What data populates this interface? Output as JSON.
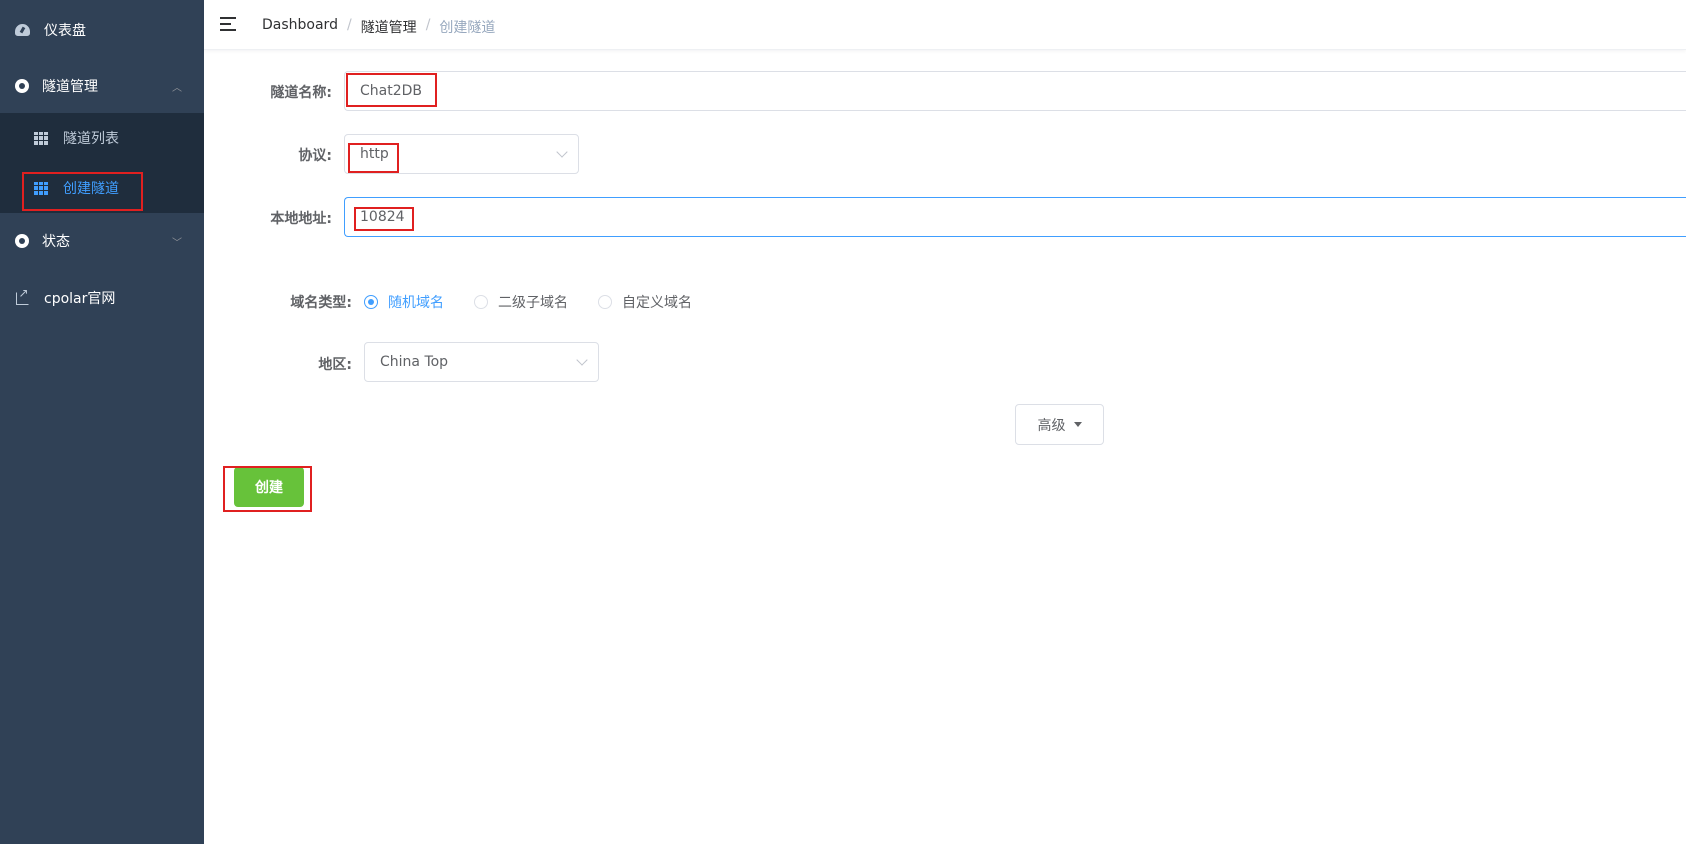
{
  "sidebar": {
    "dashboard": {
      "label": "仪表盘",
      "icon": "dashboard-icon"
    },
    "tunnel_mgmt": {
      "label": "隧道管理",
      "icon": "tunnel-icon",
      "expanded": true
    },
    "tunnel_list": {
      "label": "隧道列表",
      "icon": "table-icon"
    },
    "create_tunnel": {
      "label": "创建隧道",
      "icon": "table-icon",
      "active": true
    },
    "status": {
      "label": "状态",
      "icon": "status-icon"
    },
    "cpolar_site": {
      "label": "cpolar官网",
      "icon": "external-link-icon"
    }
  },
  "header": {
    "breadcrumb": [
      "Dashboard",
      "隧道管理",
      "创建隧道"
    ],
    "separator": "/"
  },
  "form": {
    "name": {
      "label": "隧道名称:",
      "value": "Chat2DB"
    },
    "protocol": {
      "label": "协议:",
      "value": "http"
    },
    "local_address": {
      "label": "本地地址:",
      "value": "10824"
    },
    "domain_type": {
      "label": "域名类型:",
      "options": [
        "随机域名",
        "二级子域名",
        "自定义域名"
      ],
      "selected": "随机域名"
    },
    "region": {
      "label": "地区:",
      "value": "China Top"
    },
    "advanced_label": "高级",
    "create_label": "创建"
  },
  "colors": {
    "sidebar_bg": "#304156",
    "submenu_bg": "#1f2d3d",
    "accent": "#409eff",
    "create_button": "#67c23a",
    "annotation_red": "#e02020"
  }
}
